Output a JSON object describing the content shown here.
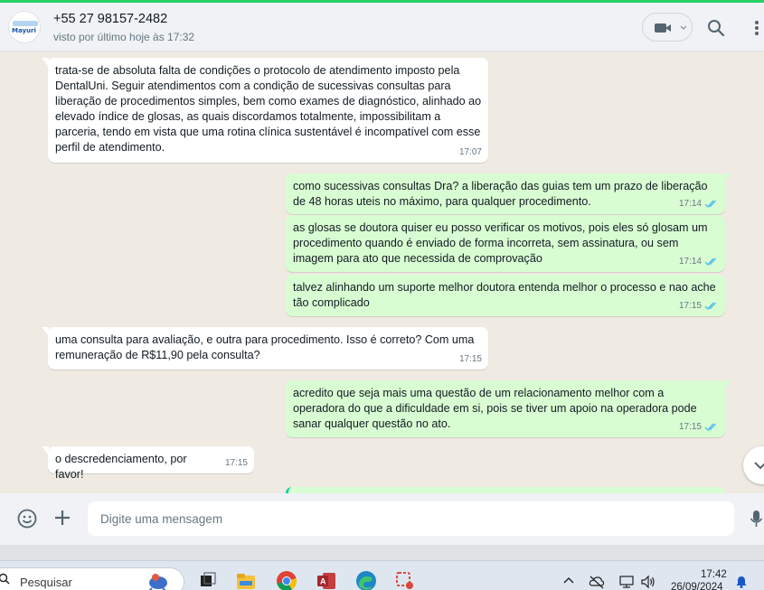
{
  "header": {
    "contact_name": "+55 27 98157-2482",
    "status": "visto por último hoje às 17:32",
    "avatar_logo_text": "Mayuri",
    "icons": [
      "video-call-icon",
      "chevron-down-icon",
      "search-icon",
      "menu-icon"
    ]
  },
  "messages": [
    {
      "dir": "in",
      "text": "trata-se de absoluta falta de condições o protocolo de atendimento imposto pela DentalUni. Seguir atendimentos com a condição de sucessivas consultas para liberação de procedimentos simples, bem como exames de diagnóstico, alinhado ao elevado índice de glosas, as quais discordamos totalmente, impossibilitam a parceria, tendo em vista que uma rotina clínica sustentável é incompatível com esse perfil de atendimento.",
      "time": "17:07"
    },
    {
      "dir": "out",
      "text": "como sucessivas consultas Dra? a liberação das guias tem um prazo de liberação de 48 horas uteis no máximo, para qualquer procedimento.",
      "time": "17:14",
      "read": true
    },
    {
      "dir": "out",
      "text": "as glosas se doutora quiser eu posso verificar os motivos, pois eles só glosam um procedimento quando é enviado de forma incorreta, sem assinatura, ou sem imagem para ato que necessida de comprovação",
      "time": "17:14",
      "read": true
    },
    {
      "dir": "out",
      "text": "talvez alinhando um suporte melhor doutora entenda melhor o processo e nao ache tão complicado",
      "time": "17:15",
      "read": true
    },
    {
      "dir": "in",
      "text": "uma consulta para avaliação, e outra para procedimento. Isso é correto? Com uma remuneração de R$11,90 pela consulta?",
      "time": "17:15"
    },
    {
      "dir": "out",
      "text": "acredito que seja mais uma questão de um relacionamento melhor com a operadora do que a dificuldade em si, pois se tiver um apoio na operadora pode sanar qualquer questão no ato.",
      "time": "17:15",
      "read": true
    },
    {
      "dir": "in",
      "text": "o descredenciamento, por favor!",
      "time": "17:15"
    }
  ],
  "composer": {
    "placeholder": "Digite uma mensagem",
    "icons": [
      "emoji-icon",
      "plus-icon",
      "microphone-icon"
    ]
  },
  "taskbar": {
    "search_text": "Pesquisar",
    "time": "17:42",
    "date": "26/09/2024",
    "apps": [
      "task-view",
      "file-explorer",
      "chrome",
      "access",
      "edge",
      "snipping-tool"
    ]
  },
  "colors": {
    "accent": "#25d366",
    "outgoing_bubble": "#d9fdd3",
    "incoming_bubble": "#ffffff",
    "chat_background": "#efeae2",
    "read_tick": "#53bdeb"
  }
}
